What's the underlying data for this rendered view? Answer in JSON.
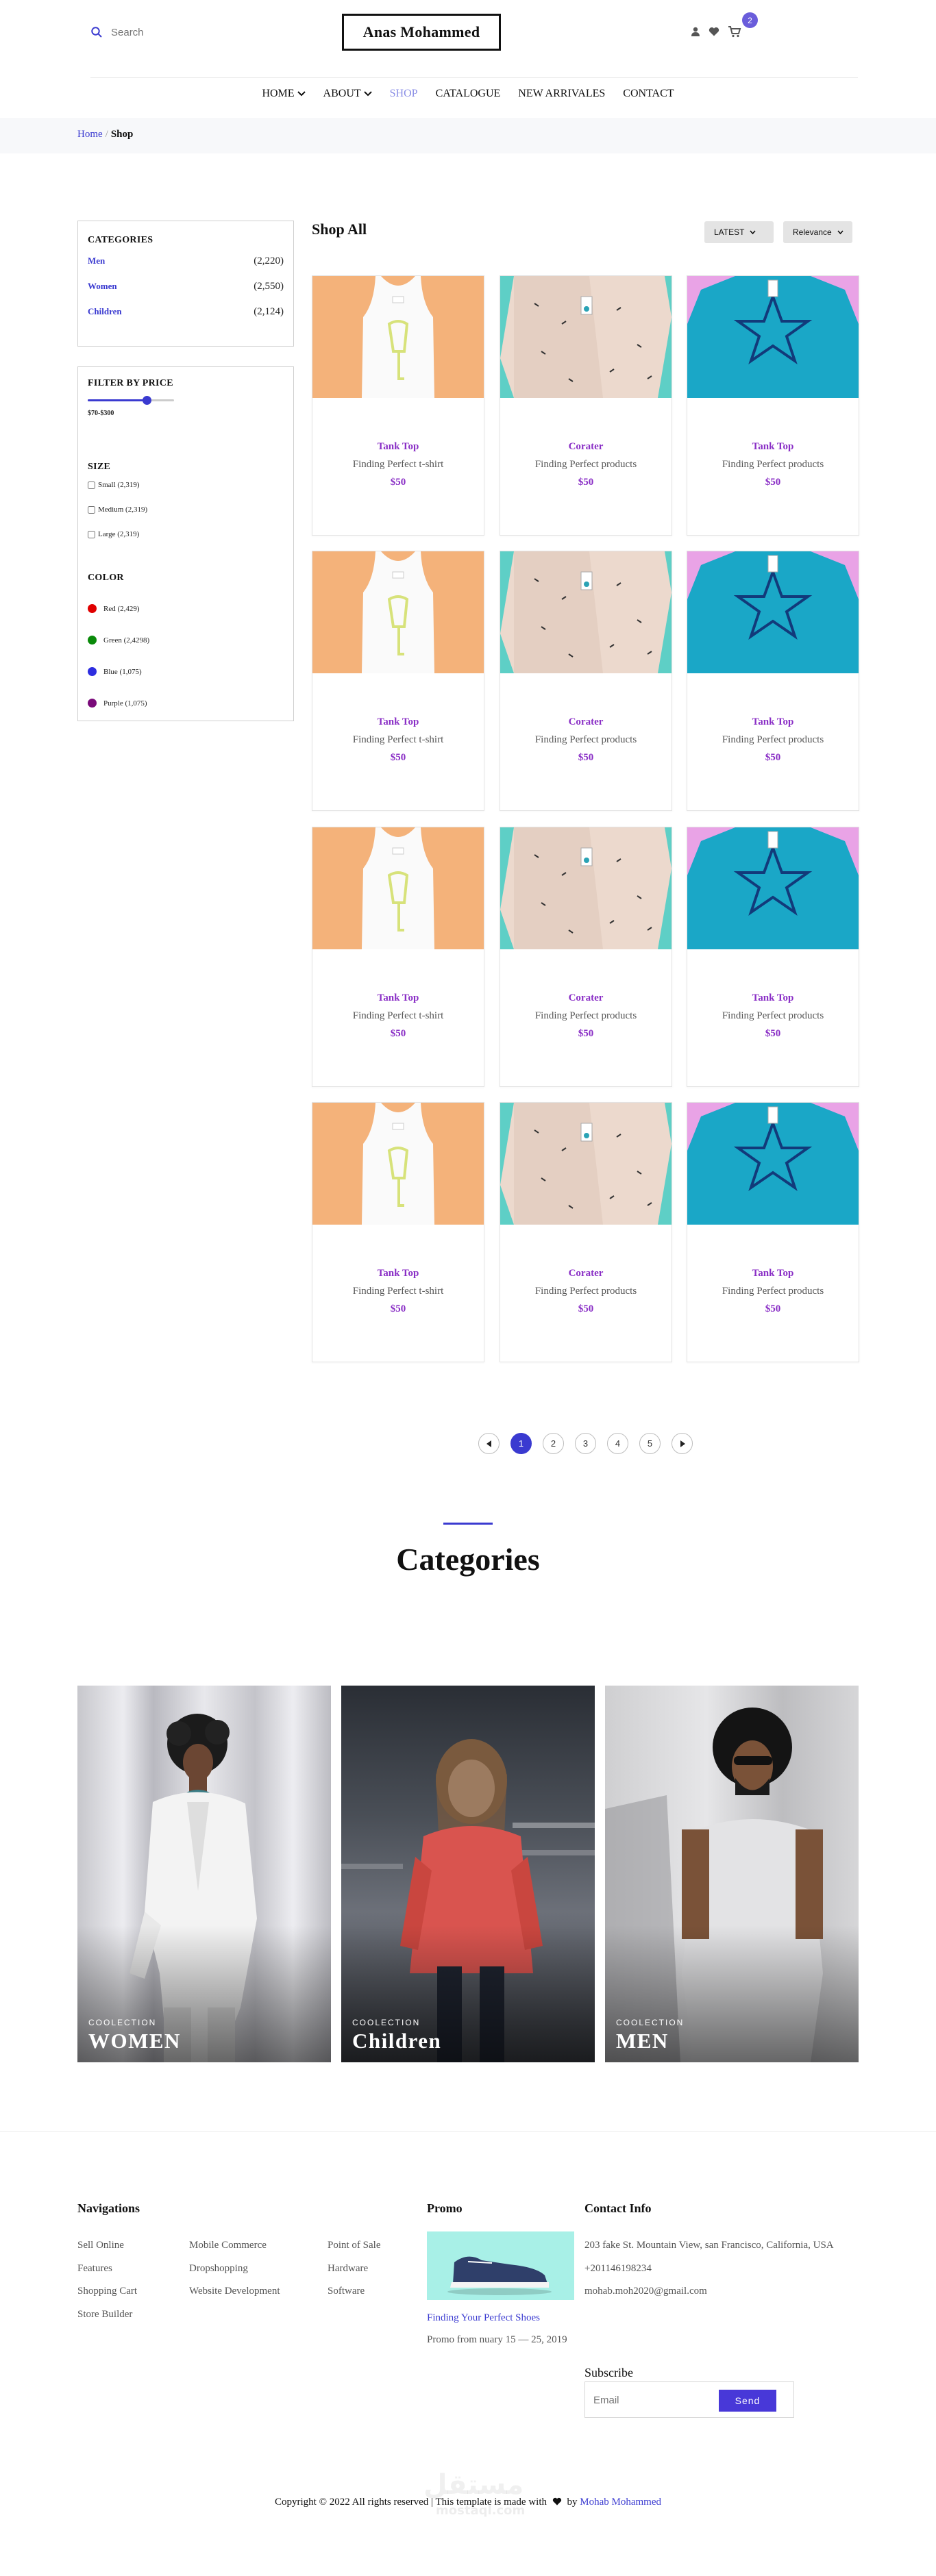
{
  "header": {
    "search_placeholder": "Search",
    "logo": "Anas Mohammed",
    "cart_count": "2"
  },
  "nav": {
    "items": [
      {
        "label": "HOME",
        "has_dropdown": true
      },
      {
        "label": "ABOUT",
        "has_dropdown": true
      },
      {
        "label": "SHOP",
        "has_dropdown": false,
        "active": true
      },
      {
        "label": "CATALOGUE",
        "has_dropdown": false
      },
      {
        "label": "NEW ARRIVALES",
        "has_dropdown": false
      },
      {
        "label": "CONTACT",
        "has_dropdown": false
      }
    ]
  },
  "breadcrumb": {
    "home": "Home",
    "separator": "/",
    "current": "Shop"
  },
  "sidebar": {
    "categories_title": "CATEGORIES",
    "categories": [
      {
        "name": "Men",
        "count": "(2,220)"
      },
      {
        "name": "Women",
        "count": "(2,550)"
      },
      {
        "name": "Children",
        "count": "(2,124)"
      }
    ],
    "filter_title": "FILTER BY PRICE",
    "price_range": "$70-$300",
    "price_slider_level": 0.68,
    "size_title": "SIZE",
    "sizes": [
      {
        "label": "Small (2,319)"
      },
      {
        "label": "Medium (2,319)"
      },
      {
        "label": "Large (2,319)"
      }
    ],
    "color_title": "COLOR",
    "colors": [
      {
        "label": "Red (2,429)",
        "color": "#e00000"
      },
      {
        "label": "Green (2,4298)",
        "color": "#0a8a0a"
      },
      {
        "label": "Blue (1,075)",
        "color": "#2d2de0"
      },
      {
        "label": "Purple (1,075)",
        "color": "#7a0a7a"
      }
    ]
  },
  "shop": {
    "title": "Shop All",
    "sort_latest": "LATEST",
    "sort_relevance": "Relevance",
    "products": [
      {
        "name": "Tank Top",
        "desc": "Finding Perfect t-shirt",
        "price": "$50",
        "image": "tank-top"
      },
      {
        "name": "Corater",
        "desc": "Finding Perfect products",
        "price": "$50",
        "image": "shirt"
      },
      {
        "name": "Tank Top",
        "desc": "Finding Perfect products",
        "price": "$50",
        "image": "blue-tee"
      },
      {
        "name": "Tank Top",
        "desc": "Finding Perfect t-shirt",
        "price": "$50",
        "image": "tank-top"
      },
      {
        "name": "Corater",
        "desc": "Finding Perfect products",
        "price": "$50",
        "image": "shirt"
      },
      {
        "name": "Tank Top",
        "desc": "Finding Perfect products",
        "price": "$50",
        "image": "blue-tee"
      },
      {
        "name": "Tank Top",
        "desc": "Finding Perfect t-shirt",
        "price": "$50",
        "image": "tank-top"
      },
      {
        "name": "Corater",
        "desc": "Finding Perfect products",
        "price": "$50",
        "image": "shirt"
      },
      {
        "name": "Tank Top",
        "desc": "Finding Perfect products",
        "price": "$50",
        "image": "blue-tee"
      },
      {
        "name": "Tank Top",
        "desc": "Finding Perfect t-shirt",
        "price": "$50",
        "image": "tank-top"
      },
      {
        "name": "Corater",
        "desc": "Finding Perfect products",
        "price": "$50",
        "image": "shirt"
      },
      {
        "name": "Tank Top",
        "desc": "Finding Perfect products",
        "price": "$50",
        "image": "blue-tee"
      }
    ]
  },
  "pagination": {
    "pages": [
      "1",
      "2",
      "3",
      "4",
      "5"
    ],
    "current": "1"
  },
  "categories_section": {
    "title": "Categories",
    "tiles": [
      {
        "kicker": "COOLECTION",
        "name": "WOMEN"
      },
      {
        "kicker": "COOLECTION",
        "name": "Children"
      },
      {
        "kicker": "COOLECTION",
        "name": "MEN"
      }
    ]
  },
  "footer": {
    "nav_title": "Navigations",
    "nav_col1": [
      "Sell Online",
      "Features",
      "Shopping Cart",
      "Store Builder"
    ],
    "nav_col2": [
      "Mobile Commerce",
      "Dropshopping",
      "Website Development"
    ],
    "nav_col3": [
      "Point of Sale",
      "Hardware",
      "Software"
    ],
    "promo_title": "Promo",
    "promo_link": "Finding Your Perfect Shoes",
    "promo_text": "Promo from nuary 15 — 25, 2019",
    "contact_title": "Contact Info",
    "address": "203 fake St. Mountain View, san Francisco, California, USA",
    "phone": "+201146198234",
    "email": "mohab.moh2020@gmail.com",
    "subscribe_title": "Subscribe",
    "subscribe_placeholder": "Email",
    "subscribe_button": "Send"
  },
  "copyright": {
    "text": "Copyright © 2022 All rights reserved | This template is made with",
    "by": "by",
    "author": "Mohab Mohammed"
  },
  "watermark": {
    "arabic": "مستقل",
    "latin": "mostaql.com"
  }
}
